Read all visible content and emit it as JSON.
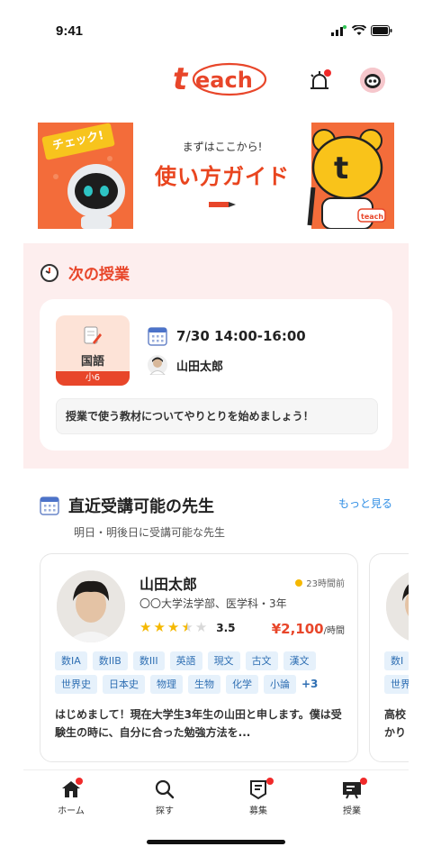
{
  "status_bar": {
    "time": "9:41"
  },
  "header": {
    "logo": "teach",
    "bell_icon": "alarm-bell-icon",
    "profile_icon": "robot-avatar-icon"
  },
  "banner": {
    "tag": "チェック!",
    "subtitle": "まずはここから!",
    "title": "使い方ガイド",
    "mascot_label": "teach"
  },
  "next_lesson": {
    "section_title": "次の授業",
    "subject": "国語",
    "grade": "小6",
    "datetime": "7/30 14:00-16:00",
    "teacher": "山田太郎",
    "message": "授業で使う教材についてやりとりを始めましょう！"
  },
  "available_teachers": {
    "title": "直近受講可能の先生",
    "more_link": "もっと見る",
    "subtitle": "明日・明後日に受講可能な先生",
    "teachers": [
      {
        "name": "山田太郎",
        "last_active": "23時間前",
        "university": "〇〇大学法学部、医学科・3年",
        "rating_value": 3.5,
        "rating": "3.5",
        "price": "¥2,100",
        "price_unit": "/時間",
        "tags": [
          "数IA",
          "数IIB",
          "数III",
          "英語",
          "現文",
          "古文",
          "漢文",
          "世界史",
          "日本史",
          "物理",
          "生物",
          "化学",
          "小論"
        ],
        "tags_more": "+3",
        "intro": "はじめまして！現在大学生3年生の山田と申します。僕は受験生の時に、自分に合った勉強方法を..."
      },
      {
        "tags": [
          "数I",
          "世界"
        ],
        "intro": "高校\nかり"
      }
    ]
  },
  "tab_bar": {
    "items": [
      {
        "label": "ホーム",
        "icon": "home-icon",
        "badge": true
      },
      {
        "label": "探す",
        "icon": "search-icon",
        "badge": false
      },
      {
        "label": "募集",
        "icon": "recruit-icon",
        "badge": true
      },
      {
        "label": "授業",
        "icon": "lesson-icon",
        "badge": true
      }
    ]
  },
  "colors": {
    "accent": "#e8462a",
    "link": "#2f8ee5",
    "tag_bg": "#e6f1fb",
    "star": "#f5b800"
  }
}
